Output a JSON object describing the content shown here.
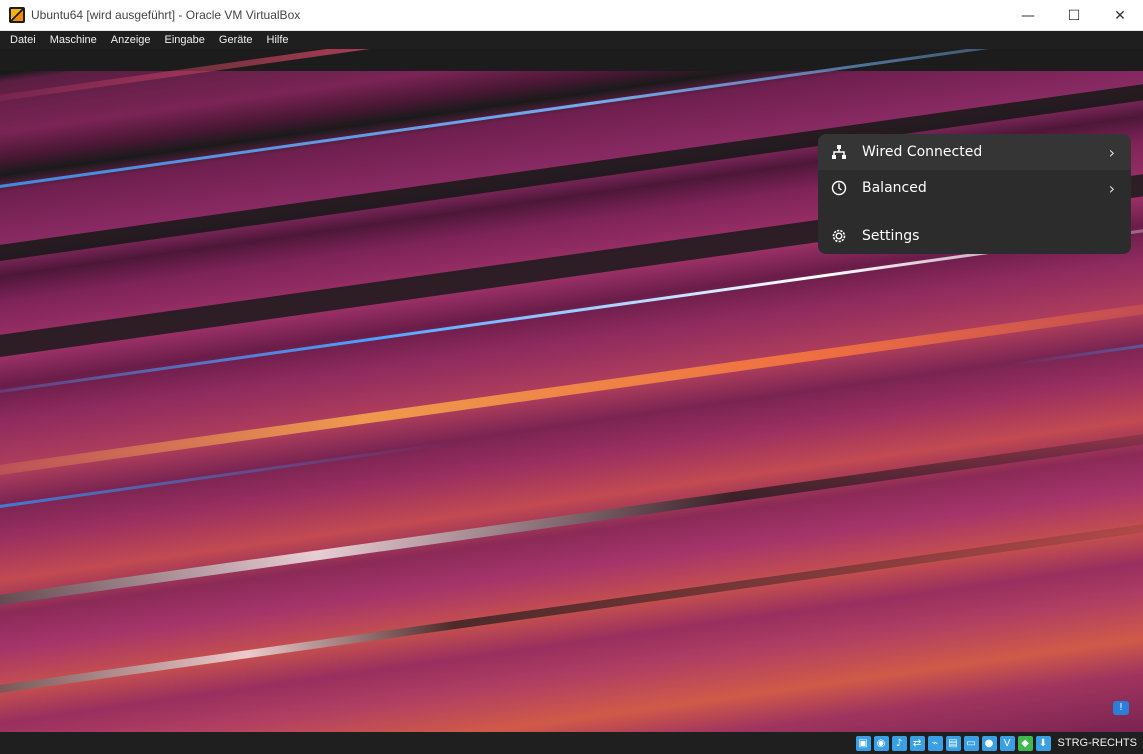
{
  "window": {
    "title": "Ubuntu64 [wird ausgeführt] - Oracle VM VirtualBox",
    "minimize_icon": "minimize-icon",
    "maximize_icon": "maximize-icon",
    "close_icon": "close-icon"
  },
  "menubar": {
    "items": [
      "Datei",
      "Maschine",
      "Anzeige",
      "Eingabe",
      "Geräte",
      "Hilfe"
    ]
  },
  "popup": {
    "wired_label": "Wired Connected",
    "balanced_label": "Balanced",
    "settings_label": "Settings"
  },
  "statusbar": {
    "host_key": "STRG-RECHTS"
  },
  "colors": {
    "popup_bg": "#2c2c2c",
    "popup_hover": "#353535",
    "menubar_bg": "#1f1f1f"
  }
}
